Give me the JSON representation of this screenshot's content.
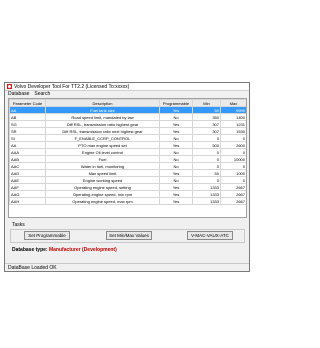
{
  "window": {
    "title": "Volvo Developer Tool For TT2.2 (Licensed To:xxxxx)"
  },
  "menu": [
    "Database",
    "Search"
  ],
  "table": {
    "headers": [
      "Parameter Code",
      "Description",
      "Programmable",
      "Min",
      "Max"
    ],
    "rows": [
      [
        "AA",
        "Fuel tank size",
        "Yes",
        "50",
        "9999"
      ],
      [
        "AB",
        "Road speed limit, mandated by law",
        "No",
        "350",
        "1400"
      ],
      [
        "SG",
        "Diff RSL, transmission ratio highest gear",
        "Yes",
        "307",
        "1231"
      ],
      [
        "SR",
        "Diff RSL, transmission ratio next highest gear",
        "Yes",
        "307",
        "1530"
      ],
      [
        "SI",
        "F_ENABLE_CCRP_CONTROL",
        "No",
        "0",
        "0"
      ],
      [
        "AA",
        "PTO max engine speed set",
        "Yes",
        "500",
        "2600"
      ],
      [
        "AAA",
        "Engine Oil level control",
        "No",
        "0",
        "0"
      ],
      [
        "AAB",
        "Fuel",
        "No",
        "0",
        "10000"
      ],
      [
        "AAC",
        "Water in fuel, monitoring",
        "No",
        "0",
        "0"
      ],
      [
        "AAD",
        "Max speed limit",
        "Yes",
        "50",
        "1000"
      ],
      [
        "AAE",
        "Engine working speed",
        "No",
        "0",
        "0"
      ],
      [
        "AAF",
        "Operating engine speed, setting",
        "Yes",
        "1333",
        "2667"
      ],
      [
        "AAG",
        "Operating engine speed, min rpm",
        "Yes",
        "1333",
        "2667"
      ],
      [
        "AAH",
        "Operating engine speed, max rpm",
        "Yes",
        "1333",
        "2667"
      ]
    ],
    "selected_index": 0
  },
  "tasks": {
    "label": "Tasks",
    "buttons": [
      "Set Programmable",
      "Set Min/Max Values",
      "V-MAC-VAUX-ATC"
    ]
  },
  "db_type": {
    "label": "Database type:",
    "value": "Manufacturer (Development)"
  },
  "status": "DataBase Loaded OK"
}
